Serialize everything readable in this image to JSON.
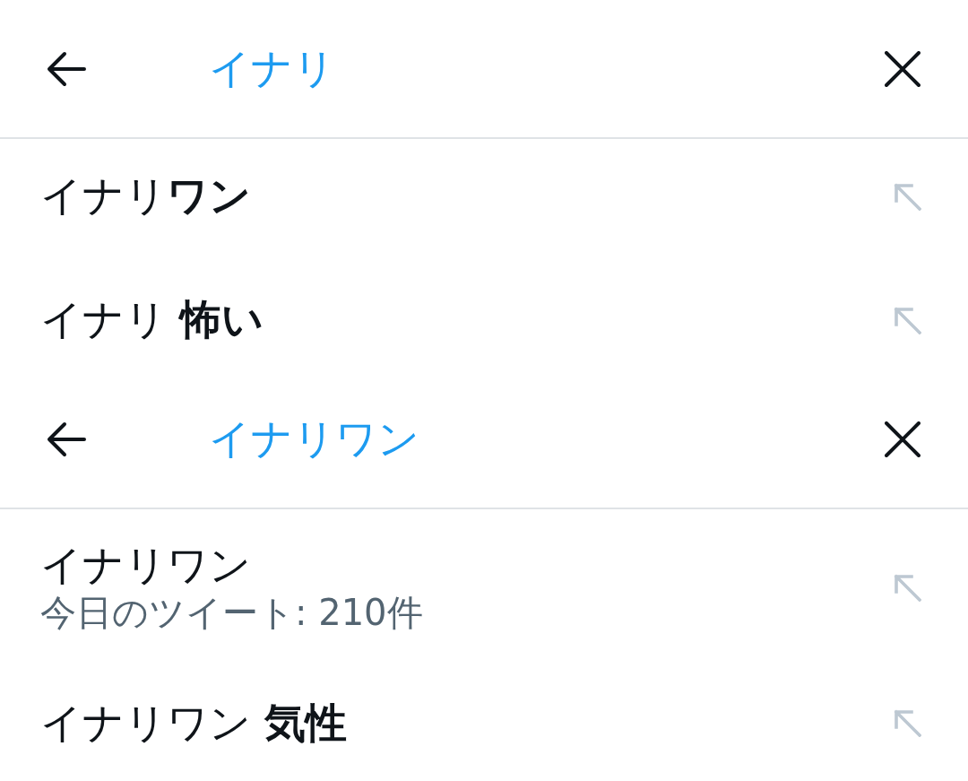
{
  "panels": [
    {
      "query": "イナリ",
      "suggestions": [
        {
          "text": "イナリ**ワン**"
        },
        {
          "text": "イナリ **怖い**"
        }
      ]
    },
    {
      "query": "イナリワン",
      "suggestions": [
        {
          "text": "イナリワン",
          "subtitle": "今日のツイート: 210件"
        },
        {
          "text": "イナリワン **気性**"
        }
      ]
    }
  ]
}
